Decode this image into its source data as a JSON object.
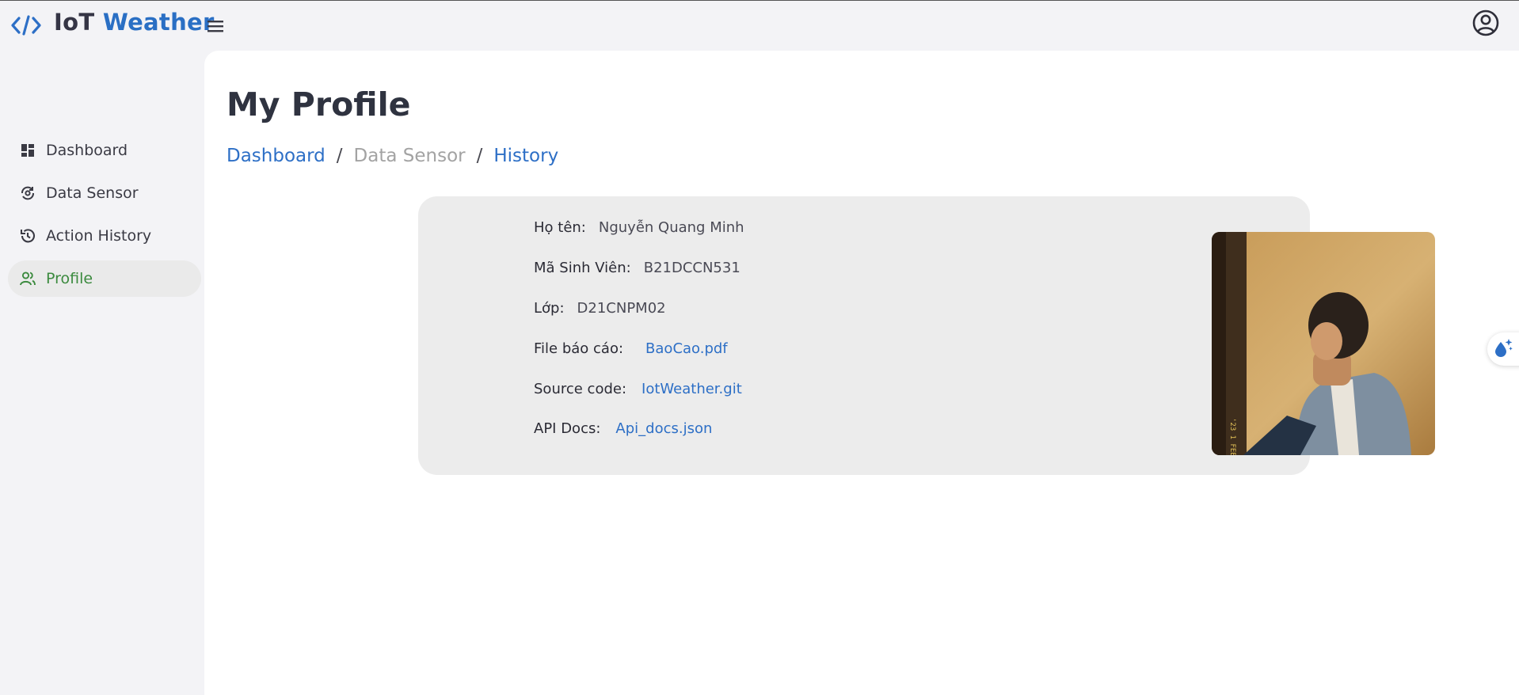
{
  "app": {
    "brand_iot": "IoT",
    "brand_weather": "Weather"
  },
  "icons": {
    "logo": "code-brackets-icon",
    "menu": "hamburger-menu-icon",
    "user": "user-circle-icon",
    "fab": "water-sparkle-icon"
  },
  "colors": {
    "accent": "#2d6fc6",
    "active": "#3b8a3e",
    "card_bg": "#ececec",
    "page_bg": "#f3f3f6"
  },
  "sidebar": {
    "items": [
      {
        "label": "Dashboard",
        "icon": "dashboard-grid-icon"
      },
      {
        "label": "Data Sensor",
        "icon": "sensor-icon"
      },
      {
        "label": "Action History",
        "icon": "history-icon"
      },
      {
        "label": "Profile",
        "icon": "users-icon",
        "active": true
      }
    ]
  },
  "main": {
    "title": "My Profile",
    "breadcrumb": {
      "home": "Dashboard",
      "middle": "Data Sensor",
      "current": "History",
      "separator": "/"
    }
  },
  "profile": {
    "name_label": "Họ tên:",
    "name_value": "Nguyễn Quang Minh",
    "id_label": "Mã Sinh Viên:",
    "id_value": "B21DCCN531",
    "class_label": "Lớp:",
    "class_value": "D21CNPM02",
    "report_label": "File báo cáo:",
    "report_link": "BaoCao.pdf",
    "source_label": "Source code:",
    "source_link": "IotWeather.git",
    "api_label": "API Docs:",
    "api_link": "Api_docs.json"
  }
}
